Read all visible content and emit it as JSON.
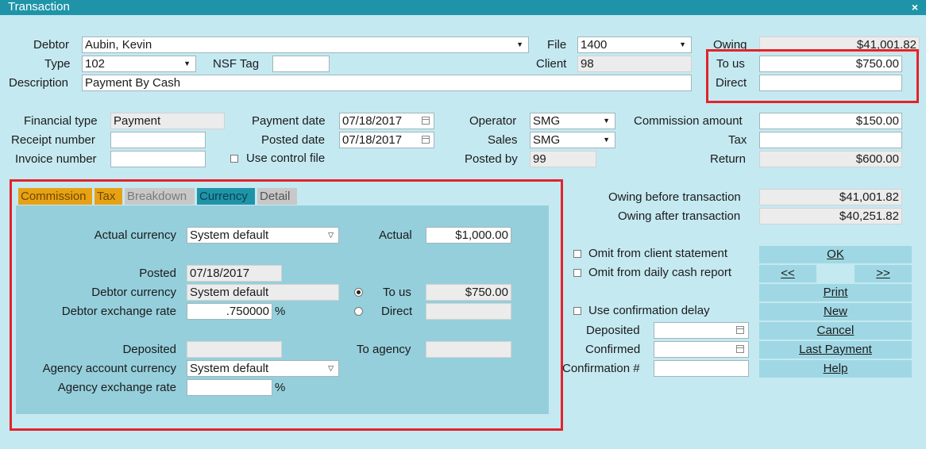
{
  "window": {
    "title": "Transaction",
    "close": "×"
  },
  "header": {
    "debtor_label": "Debtor",
    "debtor_value": "Aubin, Kevin",
    "file_label": "File",
    "file_value": "1400",
    "owing_label": "Owing",
    "owing_value": "$41,001.82",
    "type_label": "Type",
    "type_value": "102",
    "nsf_label": "NSF Tag",
    "nsf_value": "",
    "client_label": "Client",
    "client_value": "98",
    "to_us_label": "To us",
    "to_us_value": "$750.00",
    "description_label": "Description",
    "description_value": "Payment By Cash",
    "direct_label": "Direct",
    "direct_value": ""
  },
  "details": {
    "financial_type_label": "Financial type",
    "financial_type_value": "Payment",
    "payment_date_label": "Payment date",
    "payment_date_value": "07/18/2017",
    "operator_label": "Operator",
    "operator_value": "SMG",
    "commission_label": "Commission amount",
    "commission_value": "$150.00",
    "receipt_label": "Receipt number",
    "receipt_value": "",
    "posted_date_label": "Posted date",
    "posted_date_value": "07/18/2017",
    "sales_label": "Sales",
    "sales_value": "SMG",
    "tax_label": "Tax",
    "tax_value": "",
    "invoice_label": "Invoice number",
    "invoice_value": "",
    "use_control_label": "Use control file",
    "posted_by_label": "Posted by",
    "posted_by_value": "99",
    "return_label": "Return",
    "return_value": "$600.00"
  },
  "tabs": [
    "Commission",
    "Tax",
    "Breakdown",
    "Currency",
    "Detail"
  ],
  "tab_colors": {
    "commission": "#e8a114",
    "tax": "#e8a114",
    "breakdown": "#c8c8c8",
    "currency": "#1f94a9",
    "detail": "#c8c8c8"
  },
  "currency": {
    "actual_currency_label": "Actual currency",
    "actual_currency_value": "System default",
    "actual_label": "Actual",
    "actual_value": "$1,000.00",
    "posted_label": "Posted",
    "posted_value": "07/18/2017",
    "debtor_currency_label": "Debtor currency",
    "debtor_currency_value": "System default",
    "to_us_label": "To us",
    "to_us_value": "$750.00",
    "debtor_rate_label": "Debtor exchange rate",
    "debtor_rate_value": ".750000",
    "direct_label": "Direct",
    "direct_value": "",
    "deposited_label": "Deposited",
    "deposited_value": "",
    "to_agency_label": "To agency",
    "to_agency_value": "",
    "agency_currency_label": "Agency account currency",
    "agency_currency_value": "System default",
    "agency_rate_label": "Agency exchange rate",
    "agency_rate_value": "",
    "pct": "%"
  },
  "summary": {
    "before_label": "Owing before transaction",
    "before_value": "$41,001.82",
    "after_label": "Owing after transaction",
    "after_value": "$40,251.82"
  },
  "options": {
    "omit_client_label": "Omit from client statement",
    "omit_daily_label": "Omit from daily cash report",
    "use_delay_label": "Use confirmation delay",
    "deposited_label": "Deposited",
    "deposited_value": "",
    "confirmed_label": "Confirmed",
    "confirmed_value": "",
    "confirmation_label": "Confirmation #",
    "confirmation_value": ""
  },
  "buttons": {
    "ok": "OK",
    "prev": "<<",
    "next": ">>",
    "print": "Print",
    "new": "New",
    "cancel": "Cancel",
    "last_payment": "Last Payment",
    "help": "Help"
  }
}
